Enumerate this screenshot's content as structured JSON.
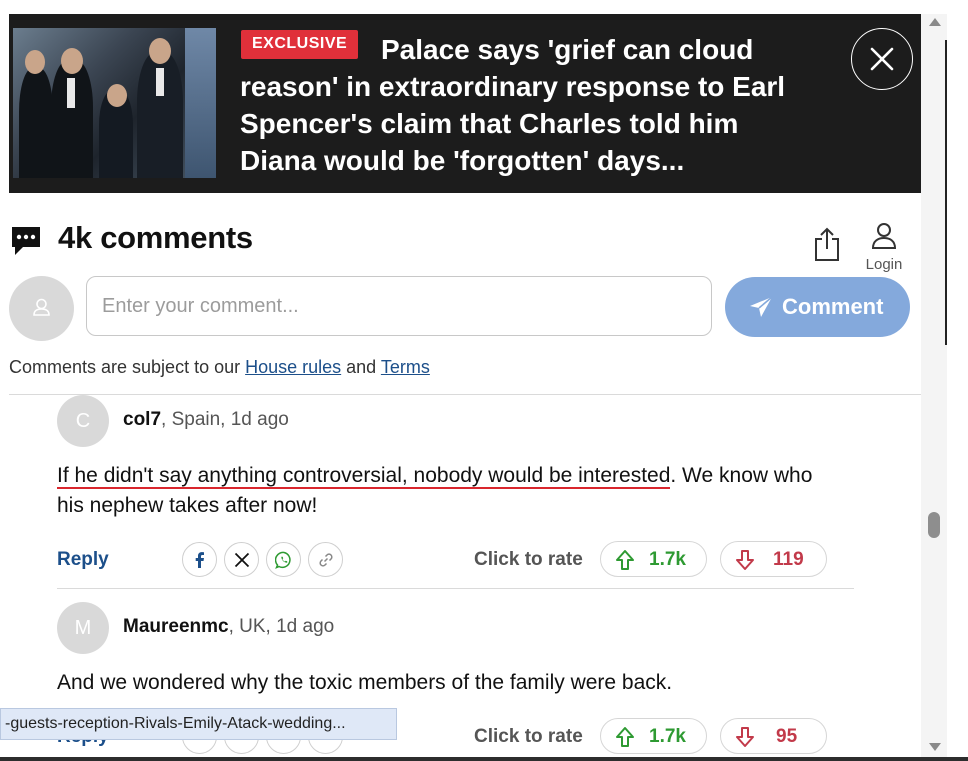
{
  "banner": {
    "badge": "EXCLUSIVE",
    "headline": "Palace says 'grief can cloud reason' in extraordinary response to Earl Spencer's claim that Charles told him Diana would be 'forgotten' days..."
  },
  "comments_header": {
    "title": "4k comments",
    "login_label": "Login"
  },
  "compose": {
    "placeholder": "Enter your comment...",
    "button_label": "Comment"
  },
  "rules": {
    "prefix": "Comments are subject to our ",
    "house_rules": "House rules",
    "and": " and ",
    "terms": "Terms"
  },
  "comments": [
    {
      "initial": "C",
      "user": "col7",
      "meta": ", Spain, 1d ago",
      "text_highlight": "If he didn't say anything controversial, nobody would be interested",
      "text_rest": ". We know who his nephew takes after now!",
      "reply": "Reply",
      "rate_label": "Click to rate",
      "upvotes": "1.7k",
      "downvotes": "119"
    },
    {
      "initial": "M",
      "user": "Maureenmc",
      "meta": ", UK, 1d ago",
      "text": "And we wondered why the toxic members of the family were back.",
      "reply": "Reply",
      "rate_label": "Click to rate",
      "upvotes": "1.7k",
      "downvotes": "95"
    }
  ],
  "status_bar": {
    "url": "-guests-reception-Rivals-Emily-Atack-wedding..."
  },
  "colors": {
    "banner_bg": "#1c1c1c",
    "badge": "#e0303a",
    "comment_button": "#84a9dc",
    "link": "#1c4f8a",
    "upvote": "#2e9a32",
    "downvote": "#c23a4a",
    "highlight_underline": "#d9262d"
  }
}
